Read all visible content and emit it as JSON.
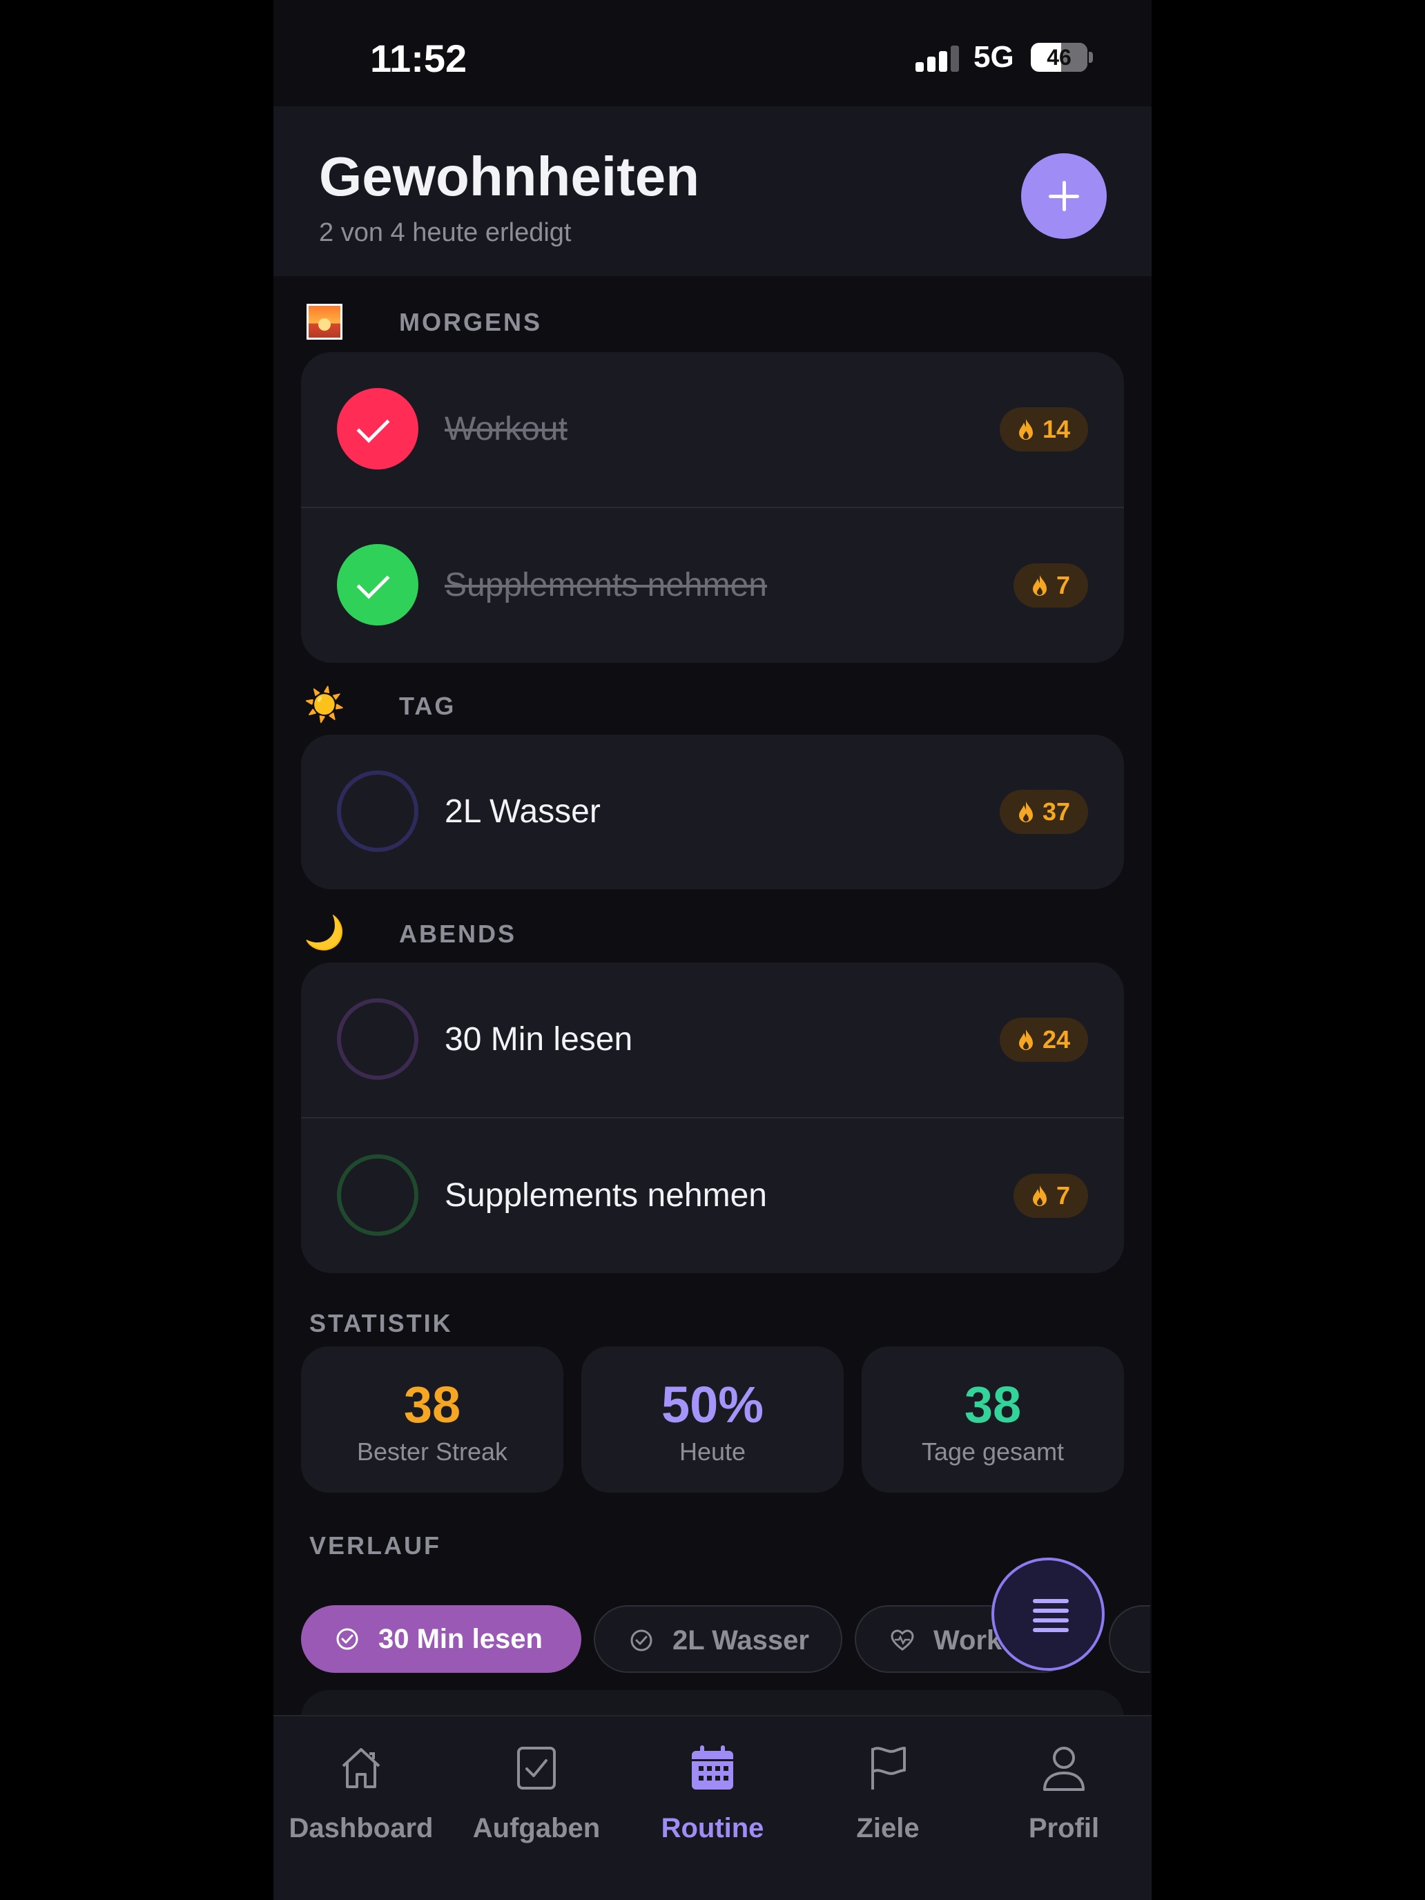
{
  "status_bar": {
    "time": "11:52",
    "network": "5G",
    "battery": "46"
  },
  "header": {
    "title": "Gewohnheiten",
    "subtitle": "2 von 4 heute erledigt",
    "add_button": "plus-icon"
  },
  "sections": [
    {
      "title": "MORGENS",
      "icon": "sunrise-icon",
      "habits": [
        {
          "label": "Workout",
          "done": true,
          "color": "#ff2d55",
          "streak": "14"
        },
        {
          "label": "Supplements nehmen",
          "done": true,
          "color": "#30d158",
          "streak": "7"
        }
      ]
    },
    {
      "title": "TAG",
      "icon": "sun-icon",
      "glyph": "☀️",
      "habits": [
        {
          "label": "2L Wasser",
          "done": false,
          "color": "#2d2a5c",
          "streak": "37"
        }
      ]
    },
    {
      "title": "ABENDS",
      "icon": "moon-icon",
      "glyph": "🌙",
      "habits": [
        {
          "label": "30 Min lesen",
          "done": false,
          "color": "#3d2a50",
          "streak": "24"
        },
        {
          "label": "Supplements nehmen",
          "done": false,
          "color": "#1f4a2d",
          "streak": "7"
        }
      ]
    }
  ],
  "stats": {
    "title": "STATISTIK",
    "items": [
      {
        "value": "38",
        "label": "Bester Streak",
        "color": "#f5a623"
      },
      {
        "value": "50%",
        "label": "Heute",
        "color": "#a594f9"
      },
      {
        "value": "38",
        "label": "Tage gesamt",
        "color": "#34d399"
      }
    ]
  },
  "history": {
    "title": "VERLAUF",
    "chips": [
      {
        "label": "30 Min lesen",
        "icon": "check-circle-icon",
        "active": true
      },
      {
        "label": "2L Wasser",
        "icon": "check-circle-icon",
        "active": false
      },
      {
        "label": "Workout",
        "icon": "heart-pulse-icon",
        "active": false
      }
    ]
  },
  "fab": {
    "icon": "menu-icon"
  },
  "tabbar": {
    "tabs": [
      {
        "label": "Dashboard",
        "icon": "home-icon",
        "active": false
      },
      {
        "label": "Aufgaben",
        "icon": "checkbox-icon",
        "active": false
      },
      {
        "label": "Routine",
        "icon": "calendar-icon",
        "active": true
      },
      {
        "label": "Ziele",
        "icon": "flag-icon",
        "active": false
      },
      {
        "label": "Profil",
        "icon": "person-icon",
        "active": false
      }
    ]
  }
}
